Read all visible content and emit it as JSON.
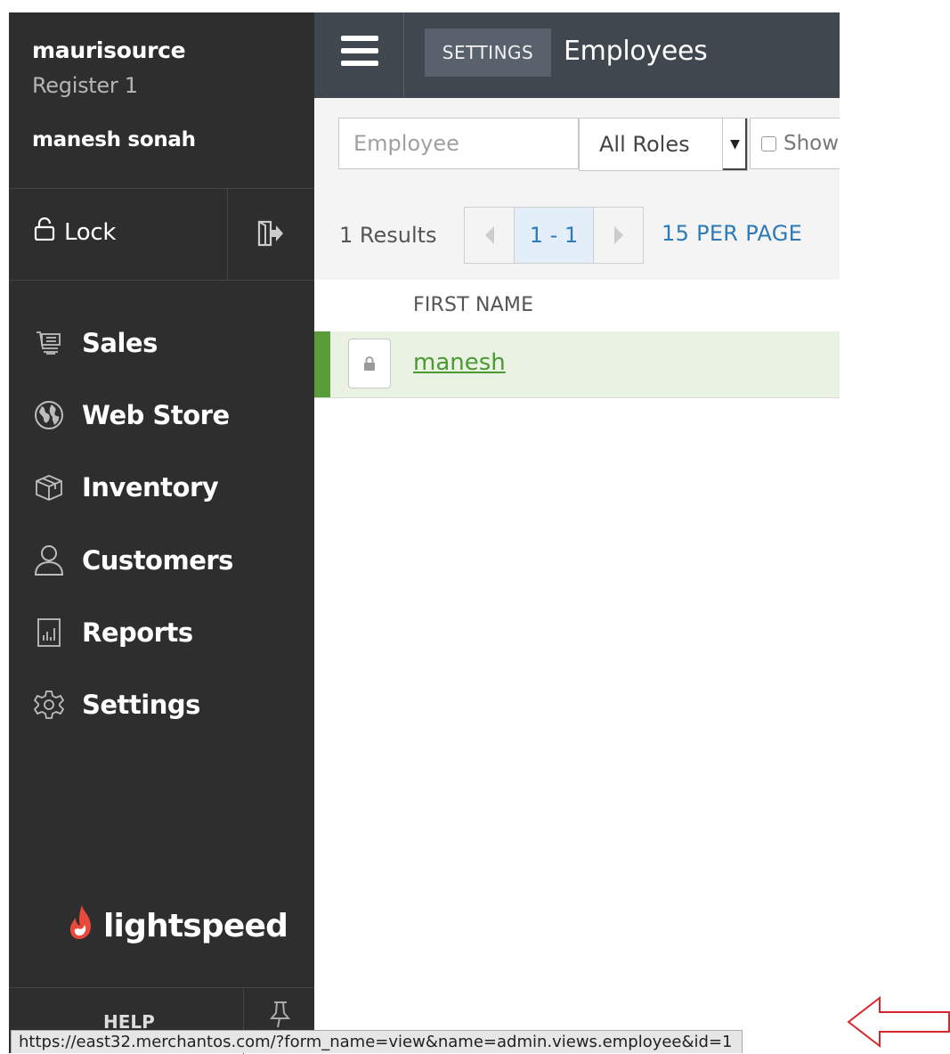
{
  "sidebar": {
    "store_name": "maurisource",
    "register_name": "Register 1",
    "user_name": "manesh sonah",
    "lock_label": "Lock",
    "nav": [
      {
        "label": "Sales",
        "icon": "register-icon"
      },
      {
        "label": "Web Store",
        "icon": "globe-icon"
      },
      {
        "label": "Inventory",
        "icon": "box-icon"
      },
      {
        "label": "Customers",
        "icon": "person-icon"
      },
      {
        "label": "Reports",
        "icon": "report-icon"
      },
      {
        "label": "Settings",
        "icon": "gear-icon"
      }
    ],
    "logo_text": "lightspeed",
    "help_label": "HELP"
  },
  "topbar": {
    "section": "SETTINGS",
    "title": "Employees"
  },
  "filters": {
    "employee_placeholder": "Employee",
    "role_value": "All Roles",
    "show_label": "Show"
  },
  "pagination": {
    "results": "1 Results",
    "range": "1 - 1",
    "per_page": "15 PER PAGE"
  },
  "table": {
    "columns": [
      "FIRST NAME"
    ],
    "rows": [
      {
        "first_name": "manesh"
      }
    ]
  },
  "status_url": "https://east32.merchantos.com/?form_name=view&name=admin.views.employee&id=1",
  "colors": {
    "sidebar_bg": "#2e2e2e",
    "topbar_bg": "#40474f",
    "link_blue": "#2e7ab8",
    "row_green": "#5a9b3a",
    "logo_red": "#e8493c",
    "arrow_red": "#d9262b"
  }
}
